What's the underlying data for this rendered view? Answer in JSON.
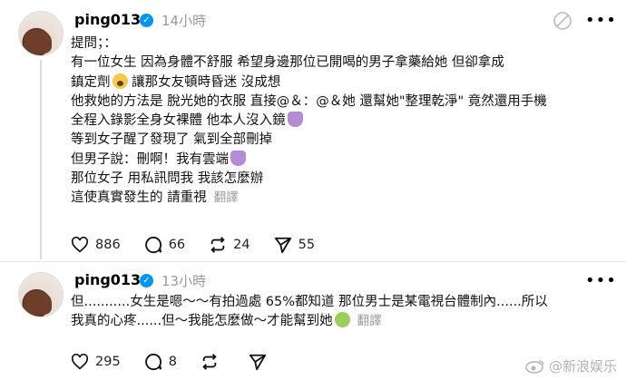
{
  "post1": {
    "username": "ping0130",
    "time": "14小時",
    "lines": [
      "提問；：",
      "有一位女生 因為身體不舒服 希望身邊那位已開喝的男子拿藥給她 但卻拿成",
      "鎮定劑",
      "讓那女友頓時昏迷 沒成想",
      "他救她的方法是 脫光她的衣服 直接@＆：@＆她 還幫她\"整理乾淨\" 竟然還用手機",
      "全程入錄影全身女裸體 他本人沒入鏡",
      "等到女子醒了發現了 氣到全部刪掉",
      "但男子說：刪啊！我有雲端",
      "那位女子 用私訊問我 我該怎麼辦",
      "這使真實發生的 請重視"
    ],
    "translate": "翻譯",
    "likes": "886",
    "comments": "66",
    "reposts": "24",
    "shares": "55"
  },
  "post2": {
    "username": "ping0130",
    "time": "13小時",
    "lines": [
      "但...........女生是嗯～～有拍過處 65%都知道 那位男士是某電視台體制內......所以",
      "我真的心疼......但～我能怎麼做～才能幫到她"
    ],
    "translate": "翻譯",
    "likes": "295",
    "comments": "8",
    "reposts": "",
    "shares": ""
  },
  "watermark": "@新浪娱乐"
}
